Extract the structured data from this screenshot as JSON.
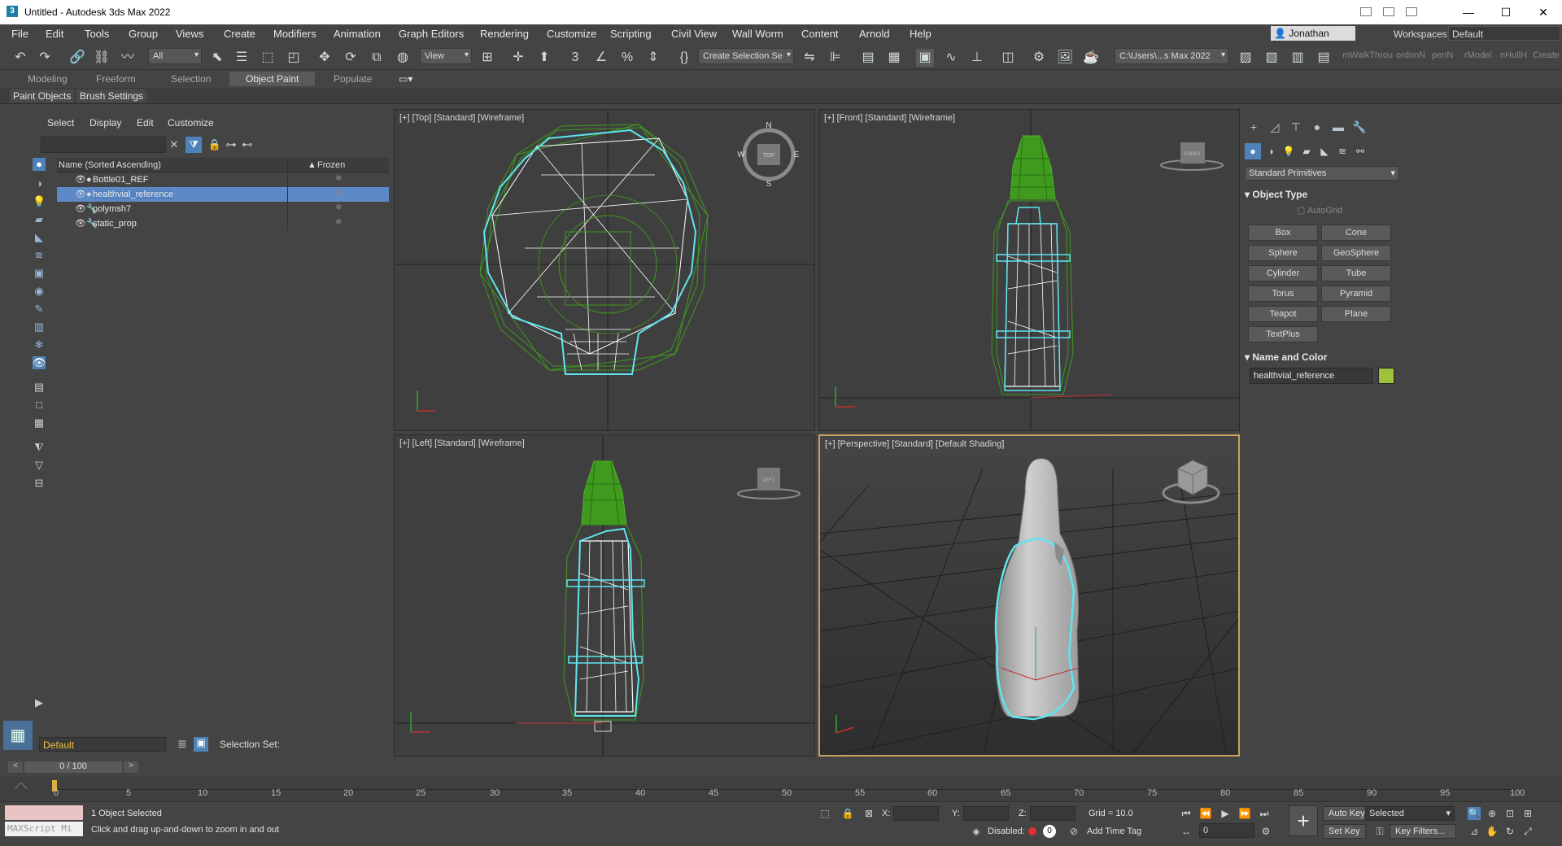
{
  "window": {
    "title": "Untitled - Autodesk 3ds Max 2022",
    "logo": "3",
    "minimize": "—",
    "maximize": "☐",
    "close": "✕"
  },
  "menu": [
    "File",
    "Edit",
    "Tools",
    "Group",
    "Views",
    "Create",
    "Modifiers",
    "Animation",
    "Graph Editors",
    "Rendering",
    "Customize",
    "Scripting",
    "Civil View",
    "Wall Worm",
    "Content",
    "Arnold",
    "Help"
  ],
  "user": {
    "name": "Jonathan Van..."
  },
  "workspaces": {
    "label": "Workspaces:",
    "value": "Default"
  },
  "toolbar": {
    "filter_value": "All",
    "ref_coord_value": "View",
    "selection_set_value": "Create Selection Se",
    "project_path": "C:\\Users\\...s Max 2022",
    "grey_items": [
      "mWalkThrou",
      "ordonN",
      "penN",
      "rModel",
      "nHullH",
      "Create"
    ]
  },
  "ribbon": {
    "tabs": [
      "Modeling",
      "Freeform",
      "Selection",
      "Object Paint",
      "Populate"
    ],
    "active_tab": "Object Paint",
    "subtabs": [
      "Paint Objects",
      "Brush Settings"
    ]
  },
  "explorer": {
    "menu": [
      "Select",
      "Display",
      "Edit",
      "Customize"
    ],
    "col_name": "Name (Sorted Ascending)",
    "col_frozen": "Frozen",
    "sort_arrow": "▲",
    "rows": [
      {
        "name": "Bottle01_REF",
        "selected": false
      },
      {
        "name": "healthvial_reference",
        "selected": true
      },
      {
        "name": "polymsh7",
        "selected": false
      },
      {
        "name": "static_prop",
        "selected": false
      }
    ],
    "layer_value": "Default",
    "selection_set_label": "Selection Set:"
  },
  "viewports": {
    "top": "[+] [Top] [Standard] [Wireframe]",
    "front": "[+] [Front] [Standard] [Wireframe]",
    "left": "[+] [Left] [Standard] [Wireframe]",
    "perspective": "[+] [Perspective] [Standard] [Default Shading]",
    "compass": {
      "n": "N",
      "s": "S",
      "e": "E",
      "w": "W"
    },
    "viewcube": {
      "top": "TOP",
      "front": "FRONT",
      "left": "LEFT"
    }
  },
  "command_panel": {
    "dropdown": "Standard Primitives",
    "object_type_title": "Object Type",
    "autogrid": "AutoGrid",
    "buttons": [
      "Box",
      "Cone",
      "Sphere",
      "GeoSphere",
      "Cylinder",
      "Tube",
      "Torus",
      "Pyramid",
      "Teapot",
      "Plane",
      "TextPlus"
    ],
    "name_color_title": "Name and Color",
    "object_name": "healthvial_reference",
    "object_color": "#9ec33a"
  },
  "timeline": {
    "frame_display": "0 / 100",
    "ticks": [
      "0",
      "5",
      "10",
      "15",
      "20",
      "25",
      "30",
      "35",
      "40",
      "45",
      "50",
      "55",
      "60",
      "65",
      "70",
      "75",
      "80",
      "85",
      "90",
      "95",
      "100"
    ]
  },
  "status": {
    "maxscript_placeholder": "MAXScript Mi",
    "objects_selected": "1 Object Selected",
    "prompt": "Click and drag up-and-down to zoom in and out",
    "x_label": "X:",
    "y_label": "Y:",
    "z_label": "Z:",
    "grid": "Grid = 10.0",
    "disabled_label": "Disabled:",
    "add_time_tag": "Add Time Tag",
    "auto_key": "Auto Key",
    "set_key": "Set Key",
    "selected_value": "Selected",
    "key_filters": "Key Filters...",
    "current_frame": "0"
  },
  "colors": {
    "selection_highlight": "#5d8ac7",
    "active_viewport_border": "#c8a25a",
    "wire_selected": "#5ee6f0",
    "wire_green": "#3f9a1e",
    "wire_white": "#ffffff"
  }
}
